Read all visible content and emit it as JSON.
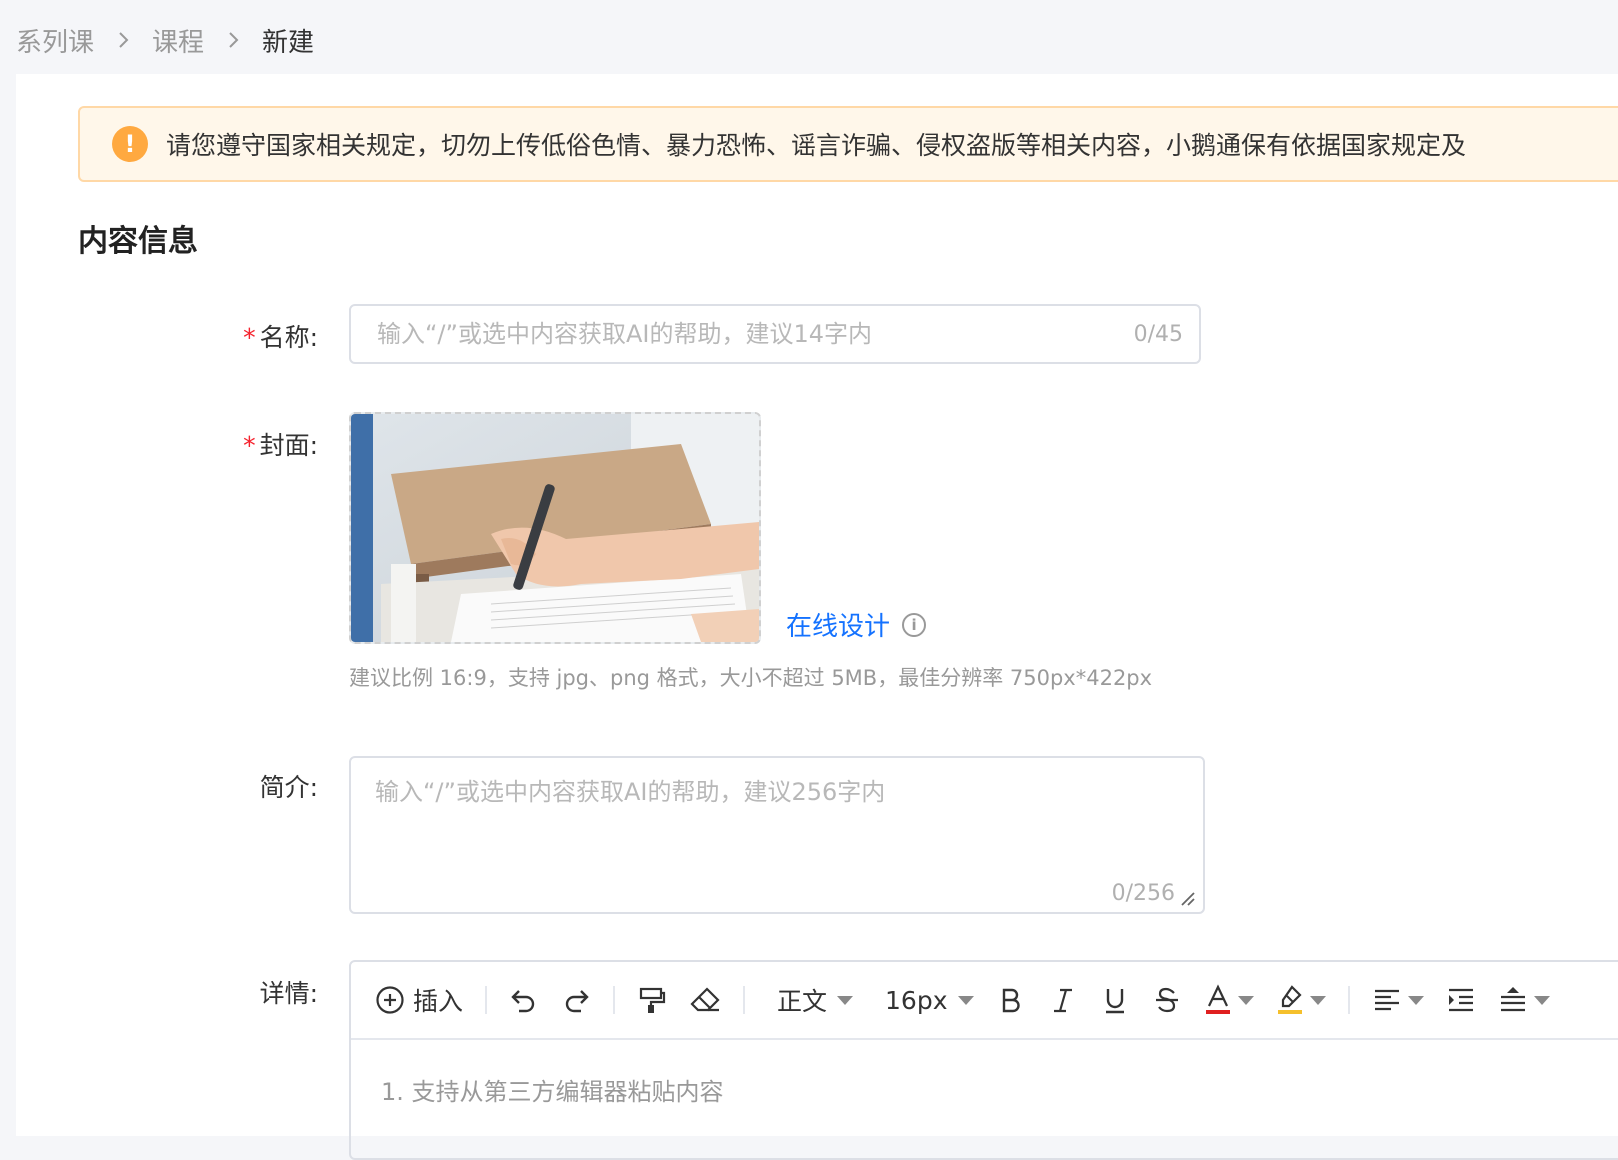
{
  "breadcrumb": {
    "items": [
      "系列课",
      "课程",
      "新建"
    ]
  },
  "notice": {
    "text": "请您遵守国家相关规定，切勿上传低俗色情、暴力恐怖、谣言诈骗、侵权盗版等相关内容，小鹅通保有依据国家规定及"
  },
  "section": {
    "title": "内容信息"
  },
  "form": {
    "name": {
      "label": "名称:",
      "placeholder": "输入“/”或选中内容获取AI的帮助，建议14字内",
      "value": "",
      "counter": "0/45"
    },
    "cover": {
      "label": "封面:",
      "online_design": "在线设计",
      "hint": "建议比例 16:9，支持 jpg、png 格式，大小不超过 5MB，最佳分辨率 750px*422px"
    },
    "intro": {
      "label": "简介:",
      "placeholder": "输入“/”或选中内容获取AI的帮助，建议256字内",
      "value": "",
      "counter": "0/256"
    },
    "details": {
      "label": "详情:",
      "toolbar": {
        "insert": "插入",
        "paragraph": "正文",
        "font_size": "16px"
      },
      "body_text": "1. 支持从第三方编辑器粘贴内容"
    }
  },
  "colors": {
    "accent": "#1472ff",
    "required": "#f5222d",
    "warning_bg": "#fff7ea",
    "warning_icon": "#ffa940"
  },
  "icons": {
    "breadcrumb_separator": "chevron-right-icon",
    "notice": "exclamation-circle-icon",
    "online_design_info": "info-circle-icon",
    "editor": [
      "plus-circle-icon",
      "undo-icon",
      "redo-icon",
      "format-painter-icon",
      "eraser-icon",
      "bold-icon",
      "italic-icon",
      "underline-icon",
      "strikethrough-icon",
      "font-color-icon",
      "highlight-icon",
      "align-left-icon",
      "indent-icon",
      "line-height-icon"
    ]
  }
}
